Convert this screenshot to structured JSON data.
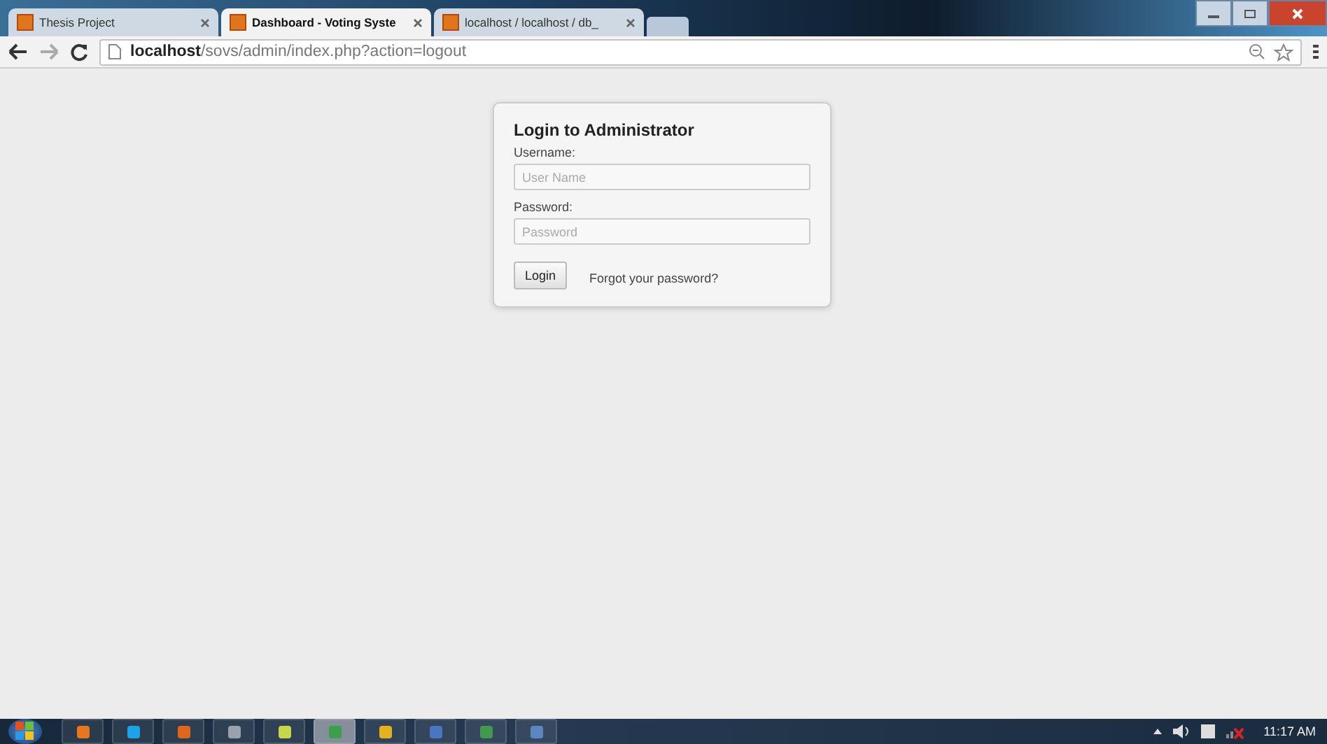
{
  "tabs": [
    {
      "label": "Thesis Project",
      "selected": false
    },
    {
      "label": "Dashboard - Voting Syste",
      "selected": true
    },
    {
      "label": "localhost / localhost / db_",
      "selected": false
    }
  ],
  "address": {
    "host": "localhost",
    "path": "/sovs/admin/index.php?action=logout"
  },
  "login": {
    "title": "Login to Administrator",
    "username_label": "Username:",
    "username_placeholder": "User Name",
    "password_label": "Password:",
    "password_placeholder": "Password",
    "button": "Login",
    "forgot_link": "Forgot your password?"
  },
  "taskbar": {
    "apps": [
      {
        "kind": "cone",
        "selected": false
      },
      {
        "kind": "chat",
        "selected": false
      },
      {
        "kind": "fox",
        "selected": false
      },
      {
        "kind": "grid",
        "selected": false
      },
      {
        "kind": "note",
        "selected": false
      },
      {
        "kind": "chrome",
        "selected": true
      },
      {
        "kind": "bulb",
        "selected": false
      },
      {
        "kind": "doc",
        "selected": false
      },
      {
        "kind": "sheet",
        "selected": false
      },
      {
        "kind": "window",
        "selected": false
      }
    ],
    "clock": "11:17 AM"
  }
}
